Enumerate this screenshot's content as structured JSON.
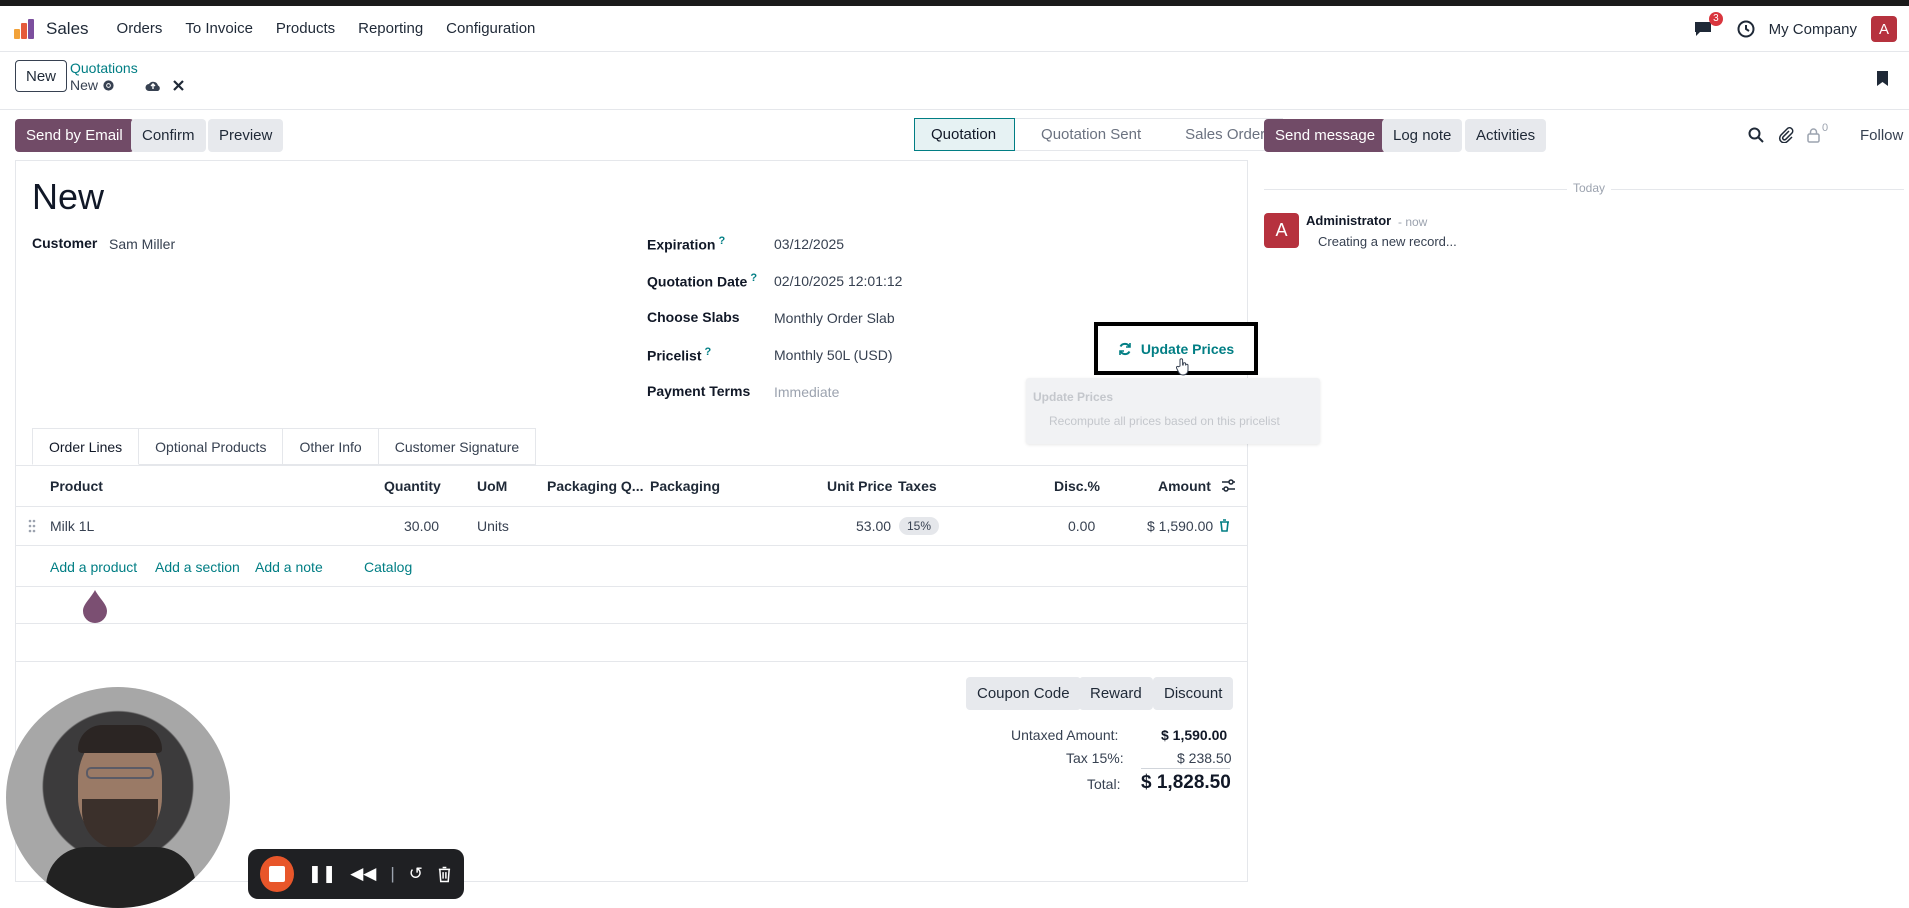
{
  "nav": {
    "app": "Sales",
    "menus": [
      "Orders",
      "To Invoice",
      "Products",
      "Reporting",
      "Configuration"
    ],
    "message_count": "3",
    "company": "My Company",
    "user_initial": "A"
  },
  "control": {
    "new_button": "New",
    "breadcrumb_parent": "Quotations",
    "breadcrumb_current": "New"
  },
  "actions": {
    "send_email": "Send by Email",
    "confirm": "Confirm",
    "preview": "Preview"
  },
  "statusbar": [
    "Quotation",
    "Quotation Sent",
    "Sales Order"
  ],
  "form": {
    "title": "New",
    "customer_label": "Customer",
    "customer_value": "Sam Miller",
    "expiration_label": "Expiration",
    "expiration_value": "03/12/2025",
    "quotation_date_label": "Quotation Date",
    "quotation_date_value": "02/10/2025 12:01:12",
    "choose_slabs_label": "Choose Slabs",
    "choose_slabs_value": "Monthly Order Slab",
    "pricelist_label": "Pricelist",
    "pricelist_value": "Monthly 50L (USD)",
    "payment_terms_label": "Payment Terms",
    "payment_terms_placeholder": "Immediate",
    "update_prices": "Update Prices",
    "qmark": "?"
  },
  "tooltip": {
    "title": "Update Prices",
    "body": "Recompute all prices based on this pricelist"
  },
  "tabs": [
    "Order Lines",
    "Optional Products",
    "Other Info",
    "Customer Signature"
  ],
  "table": {
    "headers": {
      "product": "Product",
      "quantity": "Quantity",
      "uom": "UoM",
      "packaging_qty": "Packaging Q...",
      "packaging": "Packaging",
      "unit_price": "Unit Price",
      "taxes": "Taxes",
      "disc": "Disc.%",
      "amount": "Amount"
    },
    "rows": [
      {
        "product": "Milk 1L",
        "quantity": "30.00",
        "uom": "Units",
        "unit_price": "53.00",
        "tax": "15%",
        "disc": "0.00",
        "amount": "$ 1,590.00"
      }
    ],
    "add_product": "Add a product",
    "add_section": "Add a section",
    "add_note": "Add a note",
    "catalog": "Catalog"
  },
  "promo": {
    "coupon": "Coupon Code",
    "reward": "Reward",
    "discount": "Discount"
  },
  "totals": {
    "untaxed_label": "Untaxed Amount:",
    "untaxed_value": "$ 1,590.00",
    "tax_label": "Tax 15%:",
    "tax_value": "$ 238.50",
    "total_label": "Total:",
    "total_value": "$ 1,828.50"
  },
  "chatter": {
    "send_message": "Send message",
    "log_note": "Log note",
    "activities": "Activities",
    "follower_count": "0",
    "follow": "Follow",
    "date_separator": "Today",
    "author": "Administrator",
    "time": "- now",
    "message": "Creating a new record...",
    "author_initial": "A"
  },
  "colors": {
    "primary": "#714b67",
    "accent": "#017e84",
    "recording": "#e8562a"
  }
}
